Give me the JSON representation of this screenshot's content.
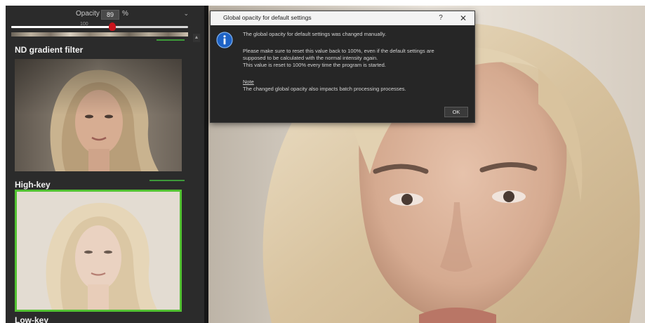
{
  "left_panel": {
    "opacity_label": "Opacity",
    "opacity_value": "89",
    "opacity_unit": "%",
    "opacity_level": 0.57,
    "slider_mini_label": "100",
    "collapse_glyph": "⌄",
    "scroll_up_glyph": "▲",
    "presets": [
      {
        "title": "ND gradient filter",
        "selected": false
      },
      {
        "title": "High-key",
        "selected": true
      },
      {
        "title": "Low-key",
        "selected": false
      }
    ]
  },
  "dialog": {
    "title": "Global opacity for default settings",
    "help_glyph": "?",
    "close_glyph": "✕",
    "icon": "info-icon",
    "lines": [
      "The global opacity for default settings was changed manually.",
      "Please make sure to reset this value back to 100%, even if the default settings are",
      "supposed to be calculated with the normal intensity again.",
      "This value is reset to 100% every time the program is started."
    ],
    "note_heading": "Note",
    "note_text": "The changed global opacity also impacts batch processing processes.",
    "ok_label": "OK"
  },
  "colors": {
    "panel_bg": "#2b2b2b",
    "selection_green": "#52c132",
    "slider_thumb": "#c8141c",
    "dialog_bg": "#262626",
    "info_blue": "#1e63c6"
  }
}
